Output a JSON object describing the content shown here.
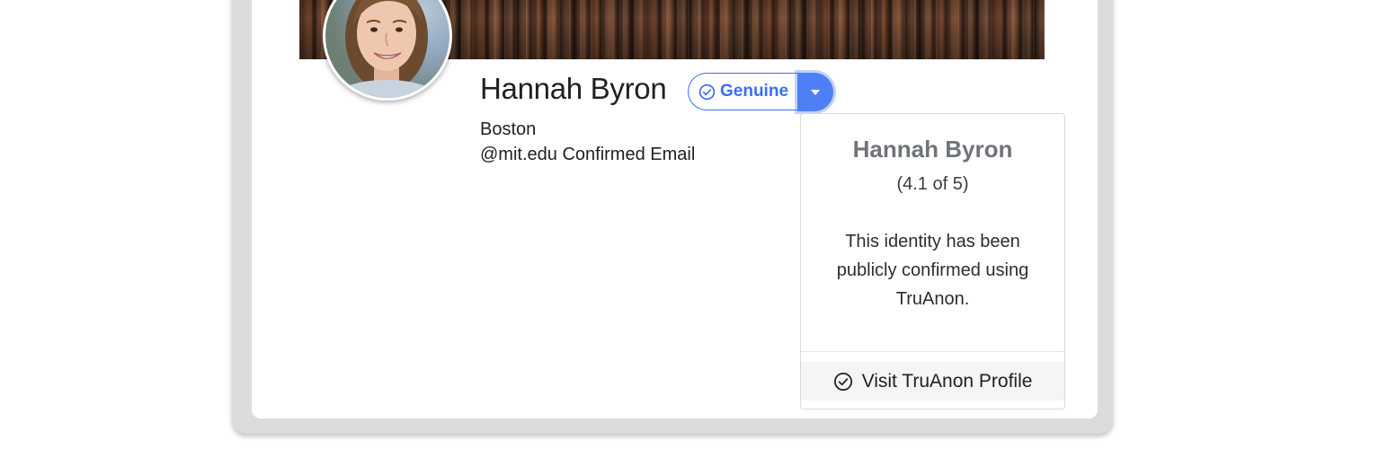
{
  "profile": {
    "name": "Hannah Byron",
    "location": "Boston",
    "email_confirmation": "@mit.edu Confirmed Email",
    "badge": {
      "label": "Genuine",
      "icon": "check-circle-icon",
      "toggle_icon": "caret-down-icon",
      "accent_color": "#3b6ef6"
    }
  },
  "popover": {
    "name": "Hannah Byron",
    "rating": "(4.1 of 5)",
    "description": "This identity has been publicly confirmed using TruAnon.",
    "footer_link": "Visit TruAnon Profile",
    "footer_icon": "check-circle-icon"
  }
}
